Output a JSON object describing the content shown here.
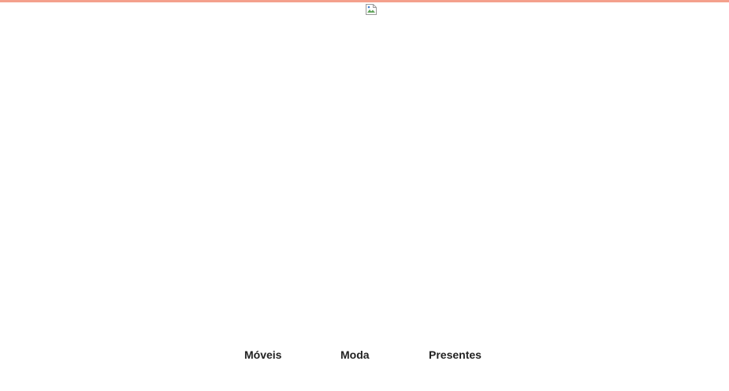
{
  "colors": {
    "top_bar": "#f4a08c",
    "nav_text": "#222222",
    "background": "#ffffff"
  },
  "header": {
    "logo_icon": "broken-image-icon"
  },
  "nav": {
    "items": [
      {
        "label": "Móveis"
      },
      {
        "label": "Moda"
      },
      {
        "label": "Presentes"
      }
    ]
  }
}
